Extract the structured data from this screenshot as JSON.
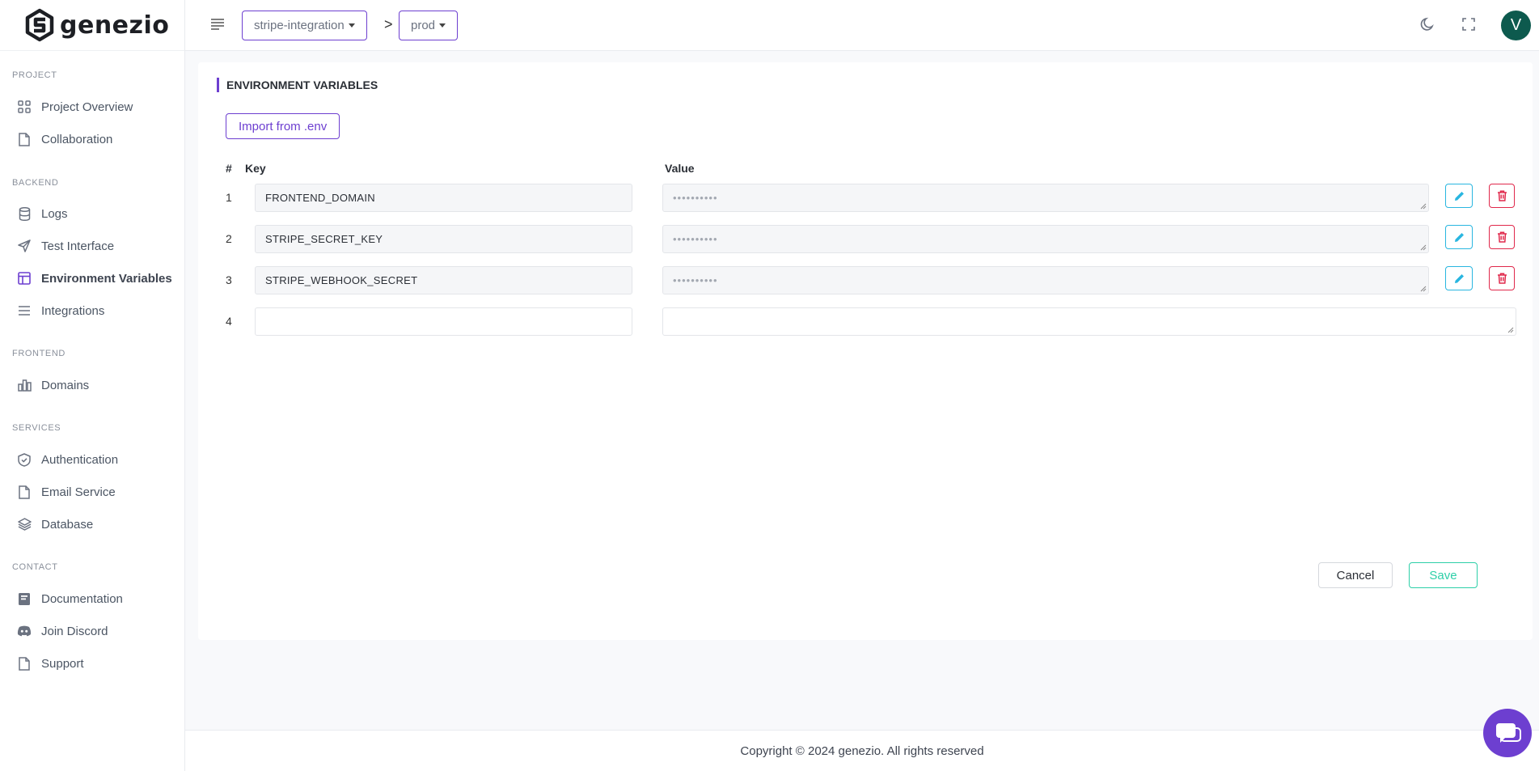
{
  "brand": {
    "name": "genezio"
  },
  "sidebar": {
    "sections": [
      {
        "title": "PROJECT",
        "items": [
          {
            "label": "Project Overview",
            "icon": "grid-icon"
          },
          {
            "label": "Collaboration",
            "icon": "file-icon"
          }
        ]
      },
      {
        "title": "BACKEND",
        "items": [
          {
            "label": "Logs",
            "icon": "database-icon"
          },
          {
            "label": "Test Interface",
            "icon": "send-icon"
          },
          {
            "label": "Environment Variables",
            "icon": "layout-icon",
            "active": true
          },
          {
            "label": "Integrations",
            "icon": "list-icon"
          }
        ]
      },
      {
        "title": "FRONTEND",
        "items": [
          {
            "label": "Domains",
            "icon": "bar-chart-icon"
          }
        ]
      },
      {
        "title": "SERVICES",
        "items": [
          {
            "label": "Authentication",
            "icon": "shield-check-icon"
          },
          {
            "label": "Email Service",
            "icon": "file-icon"
          },
          {
            "label": "Database",
            "icon": "layers-icon"
          }
        ]
      },
      {
        "title": "CONTACT",
        "items": [
          {
            "label": "Documentation",
            "icon": "book-icon"
          },
          {
            "label": "Join Discord",
            "icon": "discord-icon"
          },
          {
            "label": "Support",
            "icon": "file-icon"
          }
        ]
      }
    ]
  },
  "topbar": {
    "project": "stripe-integration",
    "separator": ">",
    "environment": "prod",
    "avatar_letter": "V"
  },
  "page": {
    "title": "ENVIRONMENT VARIABLES",
    "import_label": "Import from .env",
    "columns": {
      "num": "#",
      "key": "Key",
      "value": "Value"
    },
    "rows": [
      {
        "num": "1",
        "key": "FRONTEND_DOMAIN",
        "value": "••••••••••"
      },
      {
        "num": "2",
        "key": "STRIPE_SECRET_KEY",
        "value": "••••••••••"
      },
      {
        "num": "3",
        "key": "STRIPE_WEBHOOK_SECRET",
        "value": "••••••••••"
      },
      {
        "num": "4",
        "key": "",
        "value": ""
      }
    ],
    "cancel_label": "Cancel",
    "save_label": "Save"
  },
  "footer": {
    "text": "Copyright © 2024 genezio. All rights reserved"
  },
  "colors": {
    "accent": "#6d3fd0",
    "edit": "#29b6e0",
    "delete": "#e0284b",
    "save": "#2dcfa8"
  }
}
